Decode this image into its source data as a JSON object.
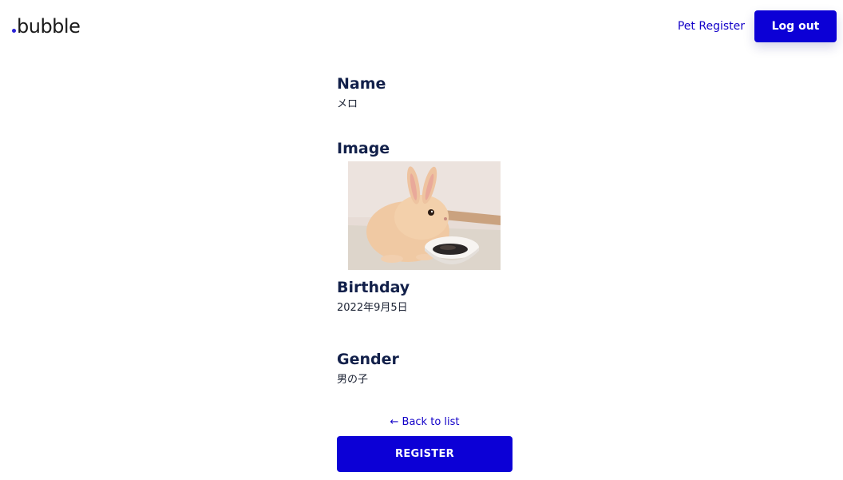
{
  "header": {
    "logo_text": "bubble",
    "nav_link": "Pet Register",
    "logout_label": "Log out"
  },
  "pet": {
    "name_label": "Name",
    "name_value": "メロ",
    "image_label": "Image",
    "image_alt": "rabbit",
    "birthday_label": "Birthday",
    "birthday_value": "2022年9月5日",
    "gender_label": "Gender",
    "gender_value": "男の子"
  },
  "actions": {
    "back_link": "← Back to list",
    "register_label": "REGISTER"
  },
  "colors": {
    "accent": "#0c00d6",
    "link": "#1200c8",
    "heading": "#12204a"
  }
}
